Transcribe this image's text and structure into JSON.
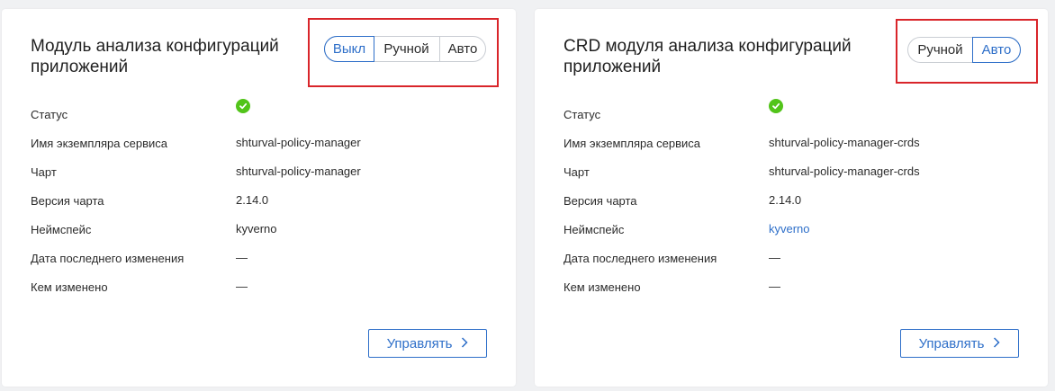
{
  "cards": [
    {
      "title": "Модуль анализа конфигураций приложений",
      "modes": [
        "Выкл",
        "Ручной",
        "Авто"
      ],
      "active_mode": "Выкл",
      "status_label": "Статус",
      "status_icon": "check-circle-icon",
      "fields": [
        {
          "label": "Имя экземпляра сервиса",
          "value": "shturval-policy-manager"
        },
        {
          "label": "Чарт",
          "value": "shturval-policy-manager"
        },
        {
          "label": "Версия чарта",
          "value": "2.14.0"
        },
        {
          "label": "Неймспейс",
          "value": "kyverno"
        },
        {
          "label": "Дата последнего изменения",
          "value": "—"
        },
        {
          "label": "Кем изменено",
          "value": "—"
        }
      ],
      "manage_label": "Управлять"
    },
    {
      "title": "CRD модуля анализа конфигураций приложений",
      "modes": [
        "Ручной",
        "Авто"
      ],
      "active_mode": "Авто",
      "status_label": "Статус",
      "status_icon": "check-circle-icon",
      "fields": [
        {
          "label": "Имя экземпляра сервиса",
          "value": "shturval-policy-manager-crds"
        },
        {
          "label": "Чарт",
          "value": "shturval-policy-manager-crds"
        },
        {
          "label": "Версия чарта",
          "value": "2.14.0"
        },
        {
          "label": "Неймспейс",
          "value": "kyverno"
        },
        {
          "label": "Дата последнего изменения",
          "value": "—"
        },
        {
          "label": "Кем изменено",
          "value": "—"
        }
      ],
      "manage_label": "Управлять"
    }
  ],
  "colors": {
    "accent": "#2e6fc9",
    "highlight": "#d9252a",
    "status_ok": "#52c41a",
    "background": "#f0f1f3"
  }
}
